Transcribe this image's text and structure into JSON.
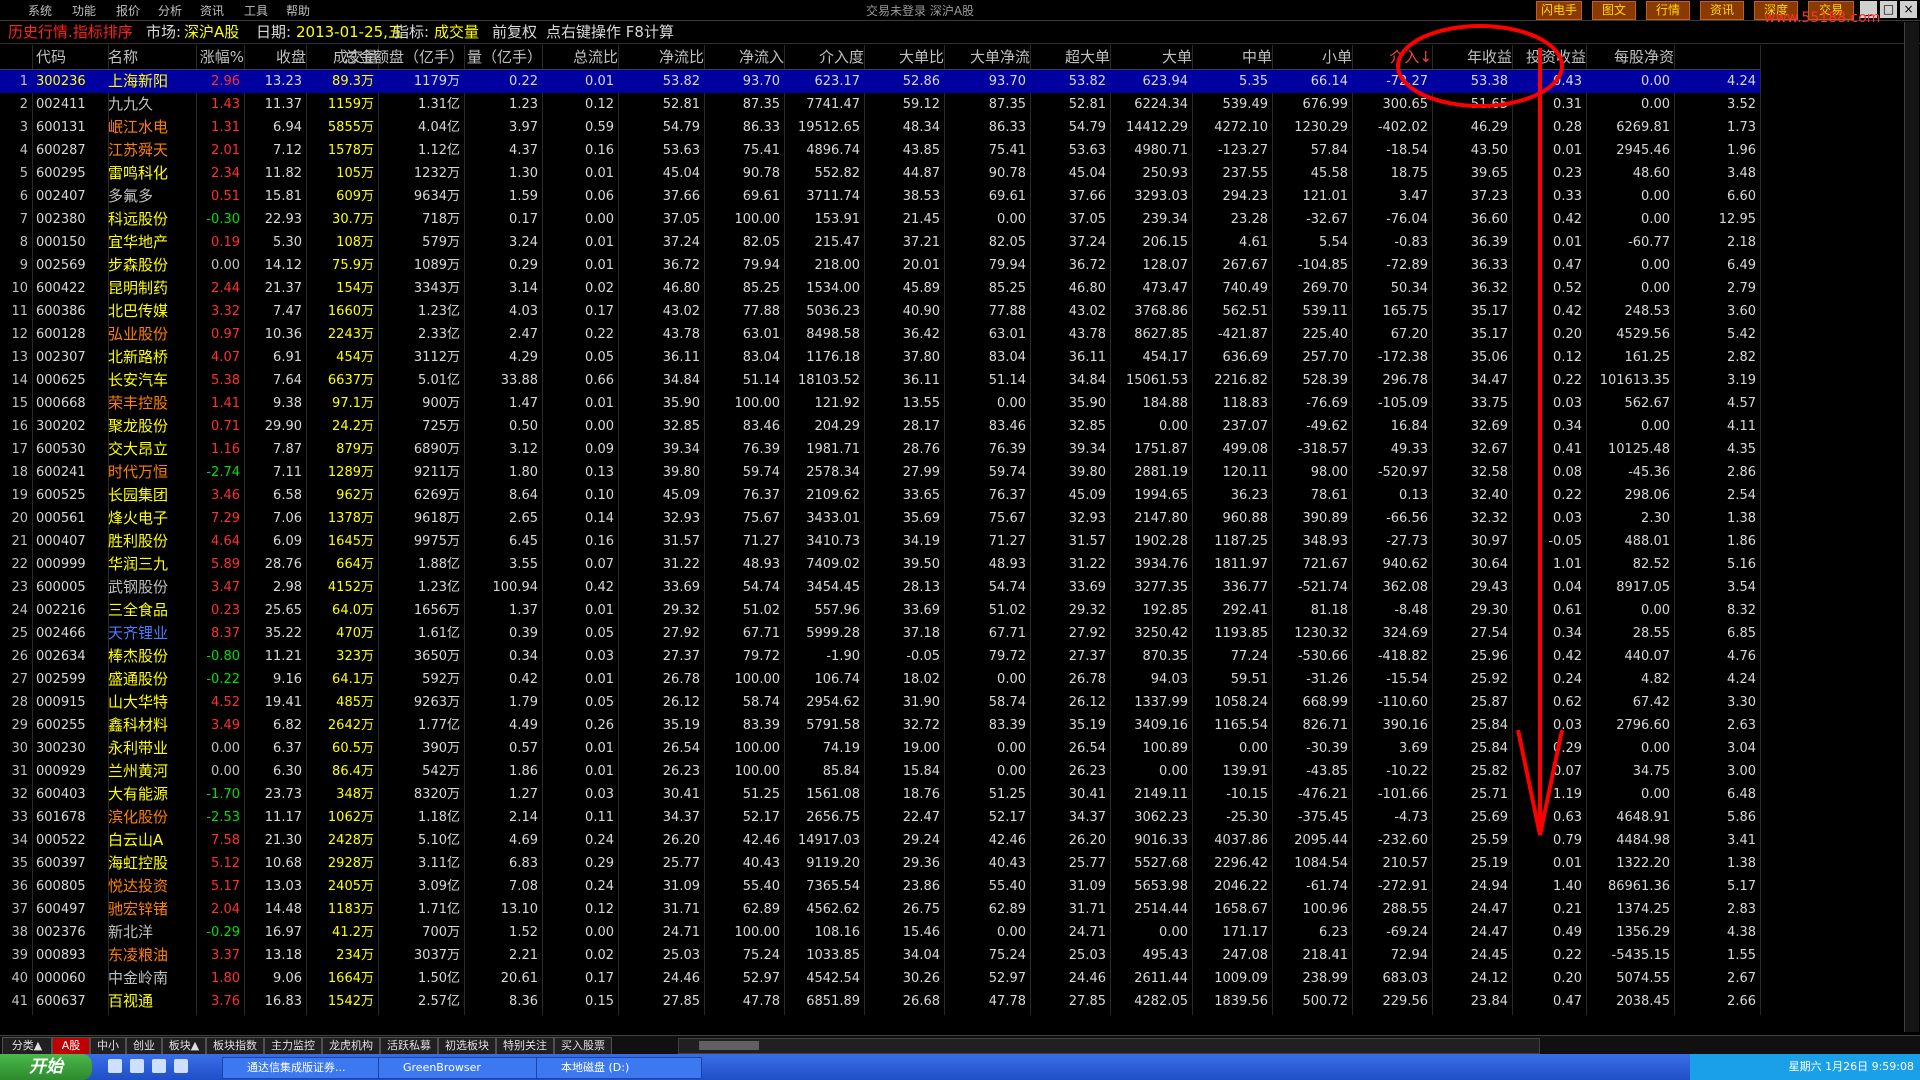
{
  "menu": [
    "系统",
    "功能",
    "报价",
    "分析",
    "资讯",
    "工具",
    "帮助"
  ],
  "menu_center": "交易未登录   深沪A股",
  "top_buttons": [
    "闪电手",
    "图文",
    "行情",
    "资讯",
    "深度",
    "交易"
  ],
  "title": {
    "view": "历史行情.指标排序",
    "market_label": "市场:",
    "market": "深沪A股",
    "date_label": "日期:",
    "date": "2013-01-25,五",
    "indicator_label": "指标:",
    "indicator": "成交量",
    "adjust": "前复权",
    "hint": "点右键操作 F8计算"
  },
  "columns": [
    "",
    "代码",
    "名称",
    "涨幅%",
    "收盘",
    "成交量",
    "总金额盘（亿手）",
    "量（亿手）",
    "总流比",
    "净流比",
    "净流入",
    "介入度",
    "大单比",
    "大单净流",
    "超大单",
    "大单",
    "中单",
    "小单",
    "介入↓",
    "年收益",
    "投资收益",
    "每股净资"
  ],
  "rows": [
    [
      "1",
      "300236",
      "上海新阳",
      "2.96",
      "13.23",
      "89.3万",
      "1179万",
      "0.22",
      "0.01",
      "53.82",
      "93.70",
      "623.17",
      "52.86",
      "93.70",
      "53.82",
      "623.94",
      "5.35",
      "66.14",
      "-72.27",
      "53.38",
      "0.43",
      "0.00",
      "4.24"
    ],
    [
      "2",
      "002411",
      "九九久",
      "1.43",
      "11.37",
      "1159万",
      "1.31亿",
      "1.23",
      "0.12",
      "52.81",
      "87.35",
      "7741.47",
      "59.12",
      "87.35",
      "52.81",
      "6224.34",
      "539.49",
      "676.99",
      "300.65",
      "51.65",
      "0.31",
      "0.00",
      "3.52"
    ],
    [
      "3",
      "600131",
      "岷江水电",
      "1.31",
      "6.94",
      "5855万",
      "4.04亿",
      "3.97",
      "0.59",
      "54.79",
      "86.33",
      "19512.65",
      "48.34",
      "86.33",
      "54.79",
      "14412.29",
      "4272.10",
      "1230.29",
      "-402.02",
      "46.29",
      "0.28",
      "6269.81",
      "1.73"
    ],
    [
      "4",
      "600287",
      "江苏舜天",
      "2.01",
      "7.12",
      "1578万",
      "1.12亿",
      "4.37",
      "0.16",
      "53.63",
      "75.41",
      "4896.74",
      "43.85",
      "75.41",
      "53.63",
      "4980.71",
      "-123.27",
      "57.84",
      "-18.54",
      "43.50",
      "0.01",
      "2945.46",
      "1.96"
    ],
    [
      "5",
      "600295",
      "雷鸣科化",
      "2.34",
      "11.82",
      "105万",
      "1232万",
      "1.30",
      "0.01",
      "45.04",
      "90.78",
      "552.82",
      "44.87",
      "90.78",
      "45.04",
      "250.93",
      "237.55",
      "45.58",
      "18.75",
      "39.65",
      "0.23",
      "48.60",
      "3.48"
    ],
    [
      "6",
      "002407",
      "多氟多",
      "0.51",
      "15.81",
      "609万",
      "9634万",
      "1.59",
      "0.06",
      "37.66",
      "69.61",
      "3711.74",
      "38.53",
      "69.61",
      "37.66",
      "3293.03",
      "294.23",
      "121.01",
      "3.47",
      "37.23",
      "0.33",
      "0.00",
      "6.60"
    ],
    [
      "7",
      "002380",
      "科远股份",
      "-0.30",
      "22.93",
      "30.7万",
      "718万",
      "0.17",
      "0.00",
      "37.05",
      "100.00",
      "153.91",
      "21.45",
      "0.00",
      "37.05",
      "239.34",
      "23.28",
      "-32.67",
      "-76.04",
      "36.60",
      "0.42",
      "0.00",
      "12.95"
    ],
    [
      "8",
      "000150",
      "宜华地产",
      "0.19",
      "5.30",
      "108万",
      "579万",
      "3.24",
      "0.01",
      "37.24",
      "82.05",
      "215.47",
      "37.21",
      "82.05",
      "37.24",
      "206.15",
      "4.61",
      "5.54",
      "-0.83",
      "36.39",
      "0.01",
      "-60.77",
      "2.18"
    ],
    [
      "9",
      "002569",
      "步森股份",
      "0.00",
      "14.12",
      "75.9万",
      "1089万",
      "0.29",
      "0.01",
      "36.72",
      "79.94",
      "218.00",
      "20.01",
      "79.94",
      "36.72",
      "128.07",
      "267.67",
      "-104.85",
      "-72.89",
      "36.33",
      "0.47",
      "0.00",
      "6.49"
    ],
    [
      "10",
      "600422",
      "昆明制药",
      "2.44",
      "21.37",
      "154万",
      "3343万",
      "3.14",
      "0.02",
      "46.80",
      "85.25",
      "1534.00",
      "45.89",
      "85.25",
      "46.80",
      "473.47",
      "740.49",
      "269.70",
      "50.34",
      "36.32",
      "0.52",
      "0.00",
      "2.79"
    ],
    [
      "11",
      "600386",
      "北巴传媒",
      "3.32",
      "7.47",
      "1660万",
      "1.23亿",
      "4.03",
      "0.17",
      "43.02",
      "77.88",
      "5036.23",
      "40.90",
      "77.88",
      "43.02",
      "3768.86",
      "562.51",
      "539.11",
      "165.75",
      "35.17",
      "0.42",
      "248.53",
      "3.60"
    ],
    [
      "12",
      "600128",
      "弘业股份",
      "0.97",
      "10.36",
      "2243万",
      "2.33亿",
      "2.47",
      "0.22",
      "43.78",
      "63.01",
      "8498.58",
      "36.42",
      "63.01",
      "43.78",
      "8627.85",
      "-421.87",
      "225.40",
      "67.20",
      "35.17",
      "0.20",
      "4529.56",
      "5.42"
    ],
    [
      "13",
      "002307",
      "北新路桥",
      "4.07",
      "6.91",
      "454万",
      "3112万",
      "4.29",
      "0.05",
      "36.11",
      "83.04",
      "1176.18",
      "37.80",
      "83.04",
      "36.11",
      "454.17",
      "636.69",
      "257.70",
      "-172.38",
      "35.06",
      "0.12",
      "161.25",
      "2.82"
    ],
    [
      "14",
      "000625",
      "长安汽车",
      "5.38",
      "7.64",
      "6637万",
      "5.01亿",
      "33.88",
      "0.66",
      "34.84",
      "51.14",
      "18103.52",
      "36.11",
      "51.14",
      "34.84",
      "15061.53",
      "2216.82",
      "528.39",
      "296.78",
      "34.47",
      "0.22",
      "101613.35",
      "3.19"
    ],
    [
      "15",
      "000668",
      "荣丰控股",
      "1.41",
      "9.38",
      "97.1万",
      "900万",
      "1.47",
      "0.01",
      "35.90",
      "100.00",
      "121.92",
      "13.55",
      "0.00",
      "35.90",
      "184.88",
      "118.83",
      "-76.69",
      "-105.09",
      "33.75",
      "0.03",
      "562.67",
      "4.57"
    ],
    [
      "16",
      "300202",
      "聚龙股份",
      "0.71",
      "29.90",
      "24.2万",
      "725万",
      "0.50",
      "0.00",
      "32.85",
      "83.46",
      "204.29",
      "28.17",
      "83.46",
      "32.85",
      "0.00",
      "237.07",
      "-49.62",
      "16.84",
      "32.69",
      "0.34",
      "0.00",
      "4.11"
    ],
    [
      "17",
      "600530",
      "交大昂立",
      "1.16",
      "7.87",
      "879万",
      "6890万",
      "3.12",
      "0.09",
      "39.34",
      "76.39",
      "1981.71",
      "28.76",
      "76.39",
      "39.34",
      "1751.87",
      "499.08",
      "-318.57",
      "49.33",
      "32.67",
      "0.41",
      "10125.48",
      "4.35"
    ],
    [
      "18",
      "600241",
      "时代万恒",
      "-2.74",
      "7.11",
      "1289万",
      "9211万",
      "1.80",
      "0.13",
      "39.80",
      "59.74",
      "2578.34",
      "27.99",
      "59.74",
      "39.80",
      "2881.19",
      "120.11",
      "98.00",
      "-520.97",
      "32.58",
      "0.08",
      "-45.36",
      "2.86"
    ],
    [
      "19",
      "600525",
      "长园集团",
      "3.46",
      "6.58",
      "962万",
      "6269万",
      "8.64",
      "0.10",
      "45.09",
      "76.37",
      "2109.62",
      "33.65",
      "76.37",
      "45.09",
      "1994.65",
      "36.23",
      "78.61",
      "0.13",
      "32.40",
      "0.22",
      "298.06",
      "2.54"
    ],
    [
      "20",
      "000561",
      "烽火电子",
      "7.29",
      "7.06",
      "1378万",
      "9618万",
      "2.65",
      "0.14",
      "32.93",
      "75.67",
      "3433.01",
      "35.69",
      "75.67",
      "32.93",
      "2147.80",
      "960.88",
      "390.89",
      "-66.56",
      "32.32",
      "0.03",
      "2.30",
      "1.38"
    ],
    [
      "21",
      "000407",
      "胜利股份",
      "4.64",
      "6.09",
      "1645万",
      "9975万",
      "6.45",
      "0.16",
      "31.57",
      "71.27",
      "3410.73",
      "34.19",
      "71.27",
      "31.57",
      "1902.28",
      "1187.25",
      "348.93",
      "-27.73",
      "30.97",
      "-0.05",
      "488.01",
      "1.86"
    ],
    [
      "22",
      "000999",
      "华润三九",
      "5.89",
      "28.76",
      "664万",
      "1.88亿",
      "3.55",
      "0.07",
      "31.22",
      "48.93",
      "7409.02",
      "39.50",
      "48.93",
      "31.22",
      "3934.76",
      "1811.97",
      "721.67",
      "940.62",
      "30.64",
      "1.01",
      "82.52",
      "5.16"
    ],
    [
      "23",
      "600005",
      "武钢股份",
      "3.47",
      "2.98",
      "4152万",
      "1.23亿",
      "100.94",
      "0.42",
      "33.69",
      "54.74",
      "3454.45",
      "28.13",
      "54.74",
      "33.69",
      "3277.35",
      "336.77",
      "-521.74",
      "362.08",
      "29.43",
      "0.04",
      "8917.05",
      "3.54"
    ],
    [
      "24",
      "002216",
      "三全食品",
      "0.23",
      "25.65",
      "64.0万",
      "1656万",
      "1.37",
      "0.01",
      "29.32",
      "51.02",
      "557.96",
      "33.69",
      "51.02",
      "29.32",
      "192.85",
      "292.41",
      "81.18",
      "-8.48",
      "29.30",
      "0.61",
      "0.00",
      "8.32"
    ],
    [
      "25",
      "002466",
      "天齐锂业",
      "8.37",
      "35.22",
      "470万",
      "1.61亿",
      "0.39",
      "0.05",
      "27.92",
      "67.71",
      "5999.28",
      "37.18",
      "67.71",
      "27.92",
      "3250.42",
      "1193.85",
      "1230.32",
      "324.69",
      "27.54",
      "0.34",
      "28.55",
      "6.85"
    ],
    [
      "26",
      "002634",
      "棒杰股份",
      "-0.80",
      "11.21",
      "323万",
      "3650万",
      "0.34",
      "0.03",
      "27.37",
      "79.72",
      "-1.90",
      "-0.05",
      "79.72",
      "27.37",
      "870.35",
      "77.24",
      "-530.66",
      "-418.82",
      "25.96",
      "0.42",
      "440.07",
      "4.76"
    ],
    [
      "27",
      "002599",
      "盛通股份",
      "-0.22",
      "9.16",
      "64.1万",
      "592万",
      "0.42",
      "0.01",
      "26.78",
      "100.00",
      "106.74",
      "18.02",
      "0.00",
      "26.78",
      "94.03",
      "59.51",
      "-31.26",
      "-15.54",
      "25.92",
      "0.24",
      "4.82",
      "4.24"
    ],
    [
      "28",
      "000915",
      "山大华特",
      "4.52",
      "19.41",
      "485万",
      "9263万",
      "1.79",
      "0.05",
      "26.12",
      "58.74",
      "2954.62",
      "31.90",
      "58.74",
      "26.12",
      "1337.99",
      "1058.24",
      "668.99",
      "-110.60",
      "25.87",
      "0.62",
      "67.42",
      "3.30"
    ],
    [
      "29",
      "600255",
      "鑫科材料",
      "3.49",
      "6.82",
      "2642万",
      "1.77亿",
      "4.49",
      "0.26",
      "35.19",
      "83.39",
      "5791.58",
      "32.72",
      "83.39",
      "35.19",
      "3409.16",
      "1165.54",
      "826.71",
      "390.16",
      "25.84",
      "0.03",
      "2796.60",
      "2.63"
    ],
    [
      "30",
      "300230",
      "永利带业",
      "0.00",
      "6.37",
      "60.5万",
      "390万",
      "0.57",
      "0.01",
      "26.54",
      "100.00",
      "74.19",
      "19.00",
      "0.00",
      "26.54",
      "100.89",
      "0.00",
      "-30.39",
      "3.69",
      "25.84",
      "0.29",
      "0.00",
      "3.04"
    ],
    [
      "31",
      "000929",
      "兰州黄河",
      "0.00",
      "6.30",
      "86.4万",
      "542万",
      "1.86",
      "0.01",
      "26.23",
      "100.00",
      "85.84",
      "15.84",
      "0.00",
      "26.23",
      "0.00",
      "139.91",
      "-43.85",
      "-10.22",
      "25.82",
      "0.07",
      "34.75",
      "3.00"
    ],
    [
      "32",
      "600403",
      "大有能源",
      "-1.70",
      "23.73",
      "348万",
      "8320万",
      "1.27",
      "0.03",
      "30.41",
      "51.25",
      "1561.08",
      "18.76",
      "51.25",
      "30.41",
      "2149.11",
      "-10.15",
      "-476.21",
      "-101.66",
      "25.71",
      "1.19",
      "0.00",
      "6.48"
    ],
    [
      "33",
      "601678",
      "滨化股份",
      "-2.53",
      "11.17",
      "1062万",
      "1.18亿",
      "2.14",
      "0.11",
      "34.37",
      "52.17",
      "2656.75",
      "22.47",
      "52.17",
      "34.37",
      "3062.23",
      "-25.30",
      "-375.45",
      "-4.73",
      "25.69",
      "0.63",
      "4648.91",
      "5.86"
    ],
    [
      "34",
      "000522",
      "白云山A",
      "7.58",
      "21.30",
      "2428万",
      "5.10亿",
      "4.69",
      "0.24",
      "26.20",
      "42.46",
      "14917.03",
      "29.24",
      "42.46",
      "26.20",
      "9016.33",
      "4037.86",
      "2095.44",
      "-232.60",
      "25.59",
      "0.79",
      "4484.98",
      "3.41"
    ],
    [
      "35",
      "600397",
      "海虹控股",
      "5.12",
      "10.68",
      "2928万",
      "3.11亿",
      "6.83",
      "0.29",
      "25.77",
      "40.43",
      "9119.20",
      "29.36",
      "40.43",
      "25.77",
      "5527.68",
      "2296.42",
      "1084.54",
      "210.57",
      "25.19",
      "0.01",
      "1322.20",
      "1.38"
    ],
    [
      "36",
      "600805",
      "悦达投资",
      "5.17",
      "13.03",
      "2405万",
      "3.09亿",
      "7.08",
      "0.24",
      "31.09",
      "55.40",
      "7365.54",
      "23.86",
      "55.40",
      "31.09",
      "5653.98",
      "2046.22",
      "-61.74",
      "-272.91",
      "24.94",
      "1.40",
      "86961.36",
      "5.17"
    ],
    [
      "37",
      "600497",
      "驰宏锌锗",
      "2.04",
      "14.48",
      "1183万",
      "1.71亿",
      "13.10",
      "0.12",
      "31.71",
      "62.89",
      "4562.62",
      "26.75",
      "62.89",
      "31.71",
      "2514.44",
      "1658.67",
      "100.96",
      "288.55",
      "24.47",
      "0.21",
      "1374.25",
      "2.83"
    ],
    [
      "38",
      "002376",
      "新北洋",
      "-0.29",
      "16.97",
      "41.2万",
      "700万",
      "1.52",
      "0.00",
      "24.71",
      "100.00",
      "108.16",
      "15.46",
      "0.00",
      "24.71",
      "0.00",
      "171.17",
      "6.23",
      "-69.24",
      "24.47",
      "0.49",
      "1356.29",
      "4.38"
    ],
    [
      "39",
      "000893",
      "东凌粮油",
      "3.37",
      "13.18",
      "234万",
      "3037万",
      "2.21",
      "0.02",
      "25.03",
      "75.24",
      "1033.85",
      "34.04",
      "75.24",
      "25.03",
      "495.43",
      "247.08",
      "218.41",
      "72.94",
      "24.45",
      "0.22",
      "-5435.15",
      "1.55"
    ],
    [
      "40",
      "000060",
      "中金岭南",
      "1.80",
      "9.06",
      "1664万",
      "1.50亿",
      "20.61",
      "0.17",
      "24.46",
      "52.97",
      "4542.54",
      "30.26",
      "52.97",
      "24.46",
      "2611.44",
      "1009.09",
      "238.99",
      "683.03",
      "24.12",
      "0.20",
      "5074.55",
      "2.67"
    ],
    [
      "41",
      "600637",
      "百视通",
      "3.76",
      "16.83",
      "1542万",
      "2.57亿",
      "8.36",
      "0.15",
      "27.85",
      "47.78",
      "6851.89",
      "26.68",
      "47.78",
      "27.85",
      "4282.05",
      "1839.56",
      "500.72",
      "229.56",
      "23.84",
      "0.47",
      "2038.45",
      "2.66"
    ]
  ],
  "name_colors": [
    "#ffff00",
    "#c0c0c0",
    "#ff8000",
    "#ff8000",
    "#ffff00",
    "#c0c0c0",
    "#ffff00",
    "#ffff00",
    "#ffff00",
    "#ffff00",
    "#ffff00",
    "#ff8000",
    "#ffff00",
    "#ffff00",
    "#ff8000",
    "#ffff00",
    "#ffff00",
    "#ff8000",
    "#ffff00",
    "#ffff00",
    "#ffff00",
    "#ffff00",
    "#c0c0c0",
    "#ffff00",
    "#4a7cff",
    "#ffff00",
    "#ffff00",
    "#ffff00",
    "#ffff00",
    "#ffff00",
    "#ffff00",
    "#ffff00",
    "#ff8000",
    "#ffff00",
    "#ffff00",
    "#ff8000",
    "#ff8000",
    "#c0c0c0",
    "#ff8000",
    "#c0c0c0",
    "#ffff00"
  ],
  "colors": {
    "up": "#ff3030",
    "down": "#00e000",
    "flat": "#c0c0c0",
    "normal": "#d8d8d8",
    "accent": "#ffff00",
    "selected": "#0000a0",
    "annotation": "#ff0000"
  },
  "tabs": [
    "分类▲",
    "A股",
    "中小",
    "创业",
    "板块▲",
    "板块指数",
    "主力监控",
    "龙虎机构",
    "活跃私募",
    "初选板块",
    "特别关注",
    "买入股票"
  ],
  "active_tab": 1,
  "taskbar": {
    "start": "开始",
    "tasks": [
      "通达信集成版证券...",
      "GreenBrowser",
      "本地磁盘 (D:)"
    ],
    "clock": "星期六 1月26日 9:59:08"
  },
  "watermark": "www.55188.com"
}
